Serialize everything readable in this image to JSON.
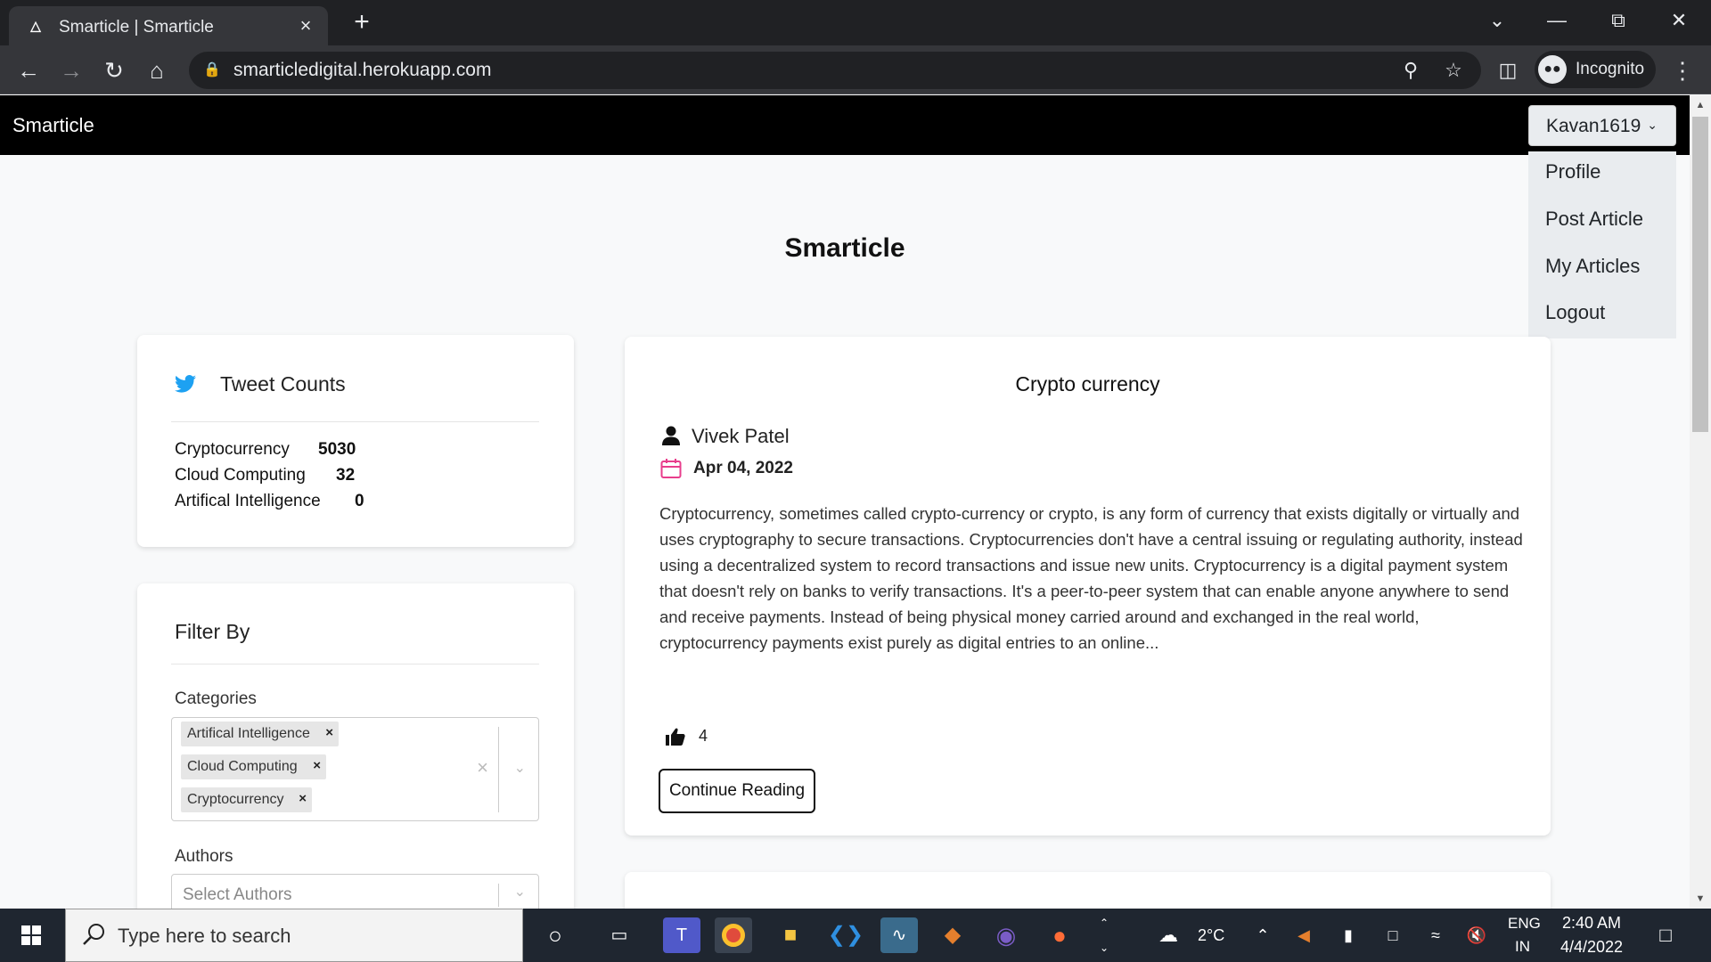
{
  "browser": {
    "tab_title": "Smarticle | Smarticle",
    "url": "smarticledigital.herokuapp.com",
    "profile_label": "Incognito"
  },
  "navbar": {
    "brand": "Smarticle",
    "user": "Kavan1619",
    "menu": [
      "Profile",
      "Post Article",
      "My Articles",
      "Logout"
    ]
  },
  "page": {
    "title": "Smarticle"
  },
  "tweet_counts": {
    "heading": "Tweet Counts",
    "items": [
      {
        "name": "Cryptocurrency",
        "count": "5030"
      },
      {
        "name": "Cloud Computing",
        "count": "32"
      },
      {
        "name": "Artifical Intelligence",
        "count": "0"
      }
    ]
  },
  "filter": {
    "heading": "Filter By",
    "categories_label": "Categories",
    "selected_categories": [
      "Artifical Intelligence",
      "Cloud Computing",
      "Cryptocurrency"
    ],
    "authors_label": "Authors",
    "authors_placeholder": "Select Authors"
  },
  "article": {
    "title": "Crypto currency",
    "author": "Vivek Patel",
    "date": "Apr 04, 2022",
    "body": "Cryptocurrency, sometimes called crypto-currency or crypto, is any form of currency that exists digitally or virtually and uses cryptography to secure transactions. Cryptocurrencies don't have a central issuing or regulating authority, instead using a decentralized system to record transactions and issue new units. Cryptocurrency is a digital payment system that doesn't rely on banks to verify transactions. It's a peer-to-peer system that can enable anyone anywhere to send and receive payments. Instead of being physical money carried around and exchanged in the real world, cryptocurrency payments exist purely as digital entries to an online...",
    "likes": "4",
    "continue_label": "Continue Reading"
  },
  "taskbar": {
    "search_placeholder": "Type here to search",
    "weather": "2°C",
    "language": "ENG",
    "region": "IN",
    "time": "2:40 AM",
    "date": "4/4/2022"
  },
  "colors": {
    "navbar": "#000000",
    "twitter": "#1da1f2",
    "calendar": "#e83e8c"
  }
}
